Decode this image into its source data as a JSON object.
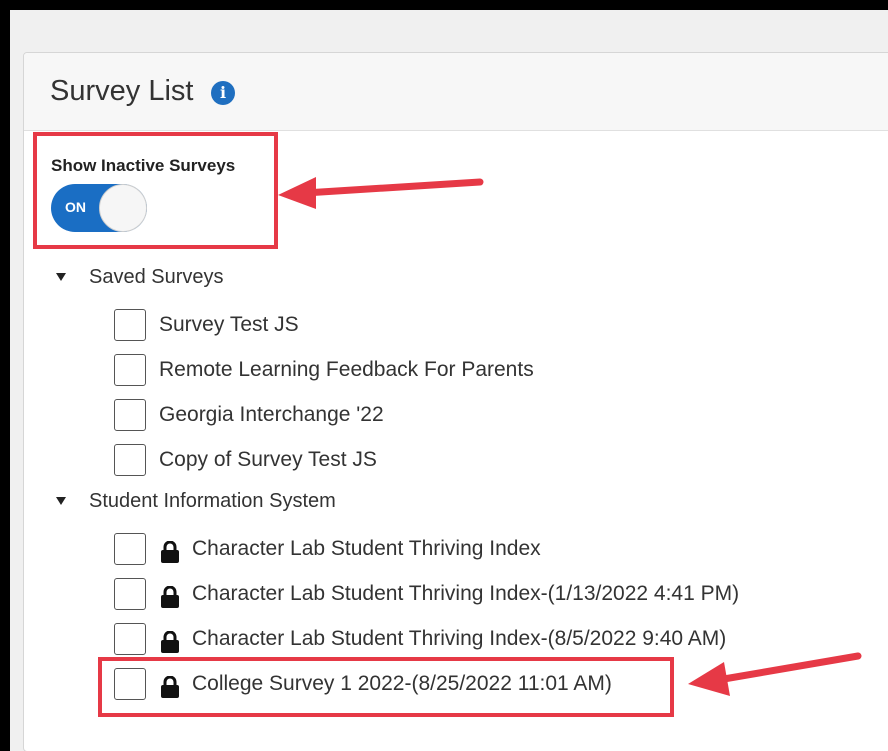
{
  "panel": {
    "title": "Survey List",
    "info_icon": "info-icon"
  },
  "toggle": {
    "label": "Show Inactive Surveys",
    "state_text": "ON",
    "on": true,
    "color": "#1a6ec4"
  },
  "groups": [
    {
      "label": "Saved Surveys",
      "items": [
        {
          "label": "Survey Test JS",
          "locked": false
        },
        {
          "label": "Remote Learning Feedback For Parents",
          "locked": false
        },
        {
          "label": "Georgia Interchange '22",
          "locked": false
        },
        {
          "label": "Copy of Survey Test JS",
          "locked": false
        }
      ]
    },
    {
      "label": "Student Information System",
      "items": [
        {
          "label": "Character Lab Student Thriving Index",
          "locked": true
        },
        {
          "label": "Character Lab Student Thriving Index-(1/13/2022 4:41 PM)",
          "locked": true
        },
        {
          "label": "Character Lab Student Thriving Index-(8/5/2022 9:40 AM)",
          "locked": true
        },
        {
          "label": "College Survey 1 2022-(8/25/2022 11:01 AM)",
          "locked": true
        }
      ]
    }
  ],
  "annotation_color": "#e63946"
}
